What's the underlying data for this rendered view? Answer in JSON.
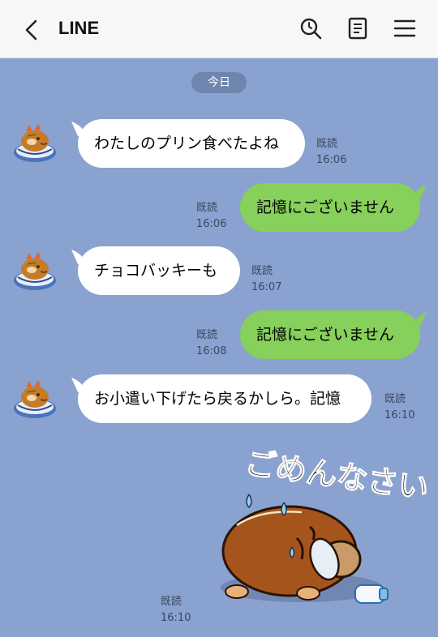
{
  "header": {
    "title": "LINE"
  },
  "date_separator": "今日",
  "messages": [
    {
      "side": "in",
      "text": "わたしのプリン食べたよね",
      "read": "既読",
      "time": "16:06"
    },
    {
      "side": "out",
      "text": "記憶にございません",
      "read": "既読",
      "time": "16:06"
    },
    {
      "side": "in",
      "text": "チョコバッキーも",
      "read": "既読",
      "time": "16:07"
    },
    {
      "side": "out",
      "text": "記憶にございません",
      "read": "既読",
      "time": "16:08"
    },
    {
      "side": "in",
      "text": "お小遣い下げたら戻るかしら。記憶",
      "read": "既読",
      "time": "16:10"
    },
    {
      "side": "out",
      "type": "sticker",
      "sticker_text": "ごめんなさい!",
      "read": "既読",
      "time": "16:10"
    }
  ],
  "colors": {
    "background": "#8aa2cf",
    "outgoing_bubble": "#86d05b",
    "incoming_bubble": "#ffffff",
    "date_pill": "#6f85ad"
  }
}
